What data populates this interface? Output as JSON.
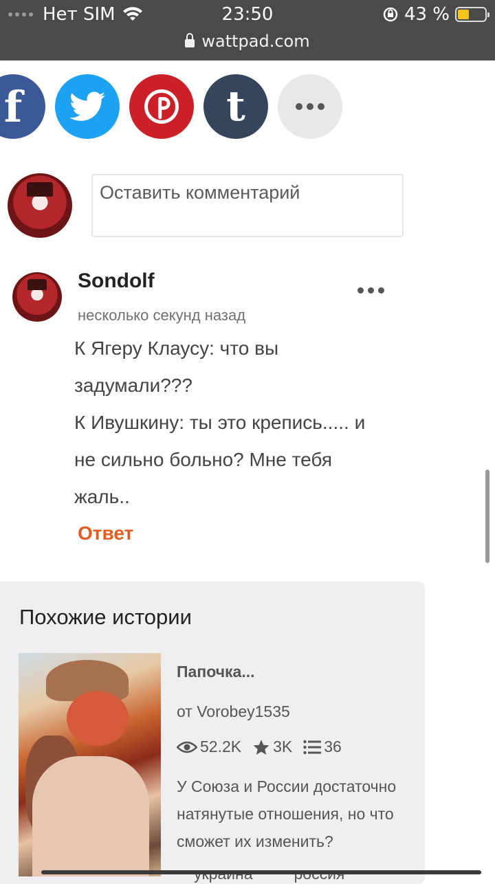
{
  "status_bar": {
    "carrier": "Нет SIM",
    "time": "23:50",
    "battery": "43 %",
    "battery_level": 0.43,
    "url": "wattpad.com"
  },
  "share": {
    "icons": [
      "facebook-icon",
      "twitter-icon",
      "pinterest-icon",
      "tumblr-icon",
      "more-icon"
    ],
    "facebook_glyph": "f",
    "tumblr_glyph": "t"
  },
  "comment_input": {
    "placeholder": "Оставить комментарий"
  },
  "comment": {
    "username": "Sondolf",
    "time": "несколько секунд назад",
    "lines": [
      "К Ягеру Клаусу: что вы",
      "задумали???",
      "К Ивушкину: ты это крепись..... и",
      "не сильно больно?  Мне тебя",
      "жаль.."
    ],
    "reply_label": "Ответ"
  },
  "similar": {
    "title": "Похожие истории",
    "story": {
      "title": "Папочка...",
      "author": "от Vorobey1535",
      "reads": "52.2K",
      "votes": "3K",
      "parts": "36",
      "description": "У Союза и России достаточно натянутые отношения, но что сможет их изменить?",
      "tags": [
        "украина",
        "россия"
      ]
    }
  },
  "colors": {
    "facebook": "#3b5998",
    "twitter": "#1da1f2",
    "pinterest": "#cb2027",
    "tumblr": "#35465c",
    "reply": "#e45d20"
  }
}
